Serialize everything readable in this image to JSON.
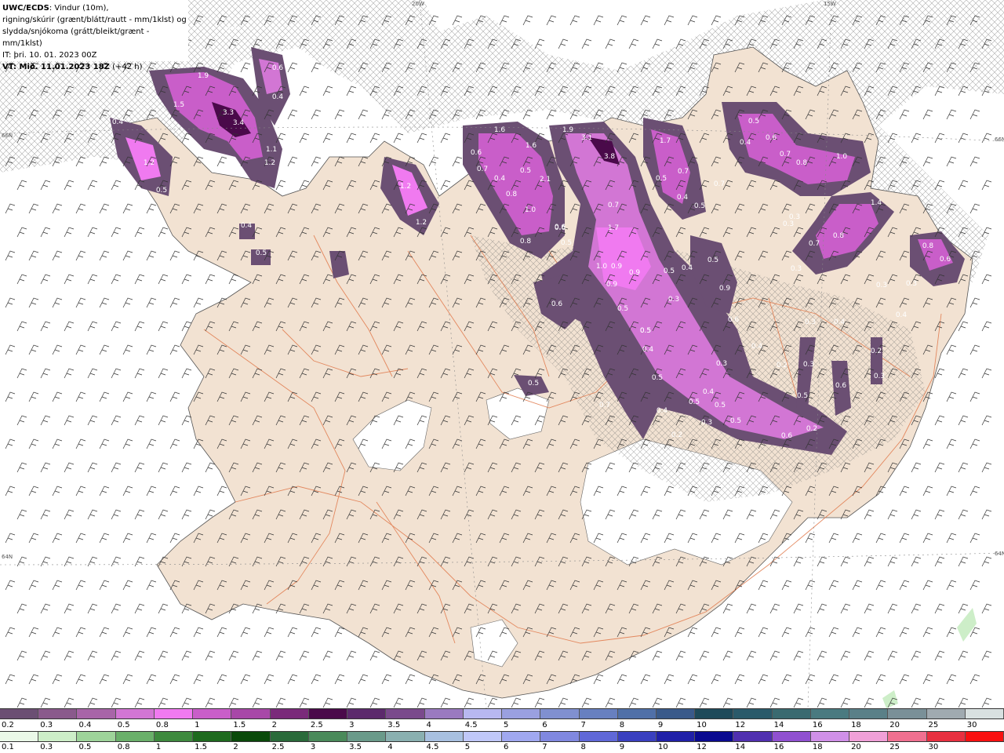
{
  "header": {
    "model": "UWC/ECDS",
    "model_suffix": ": Vindur (10m),",
    "line2": "rigning/skúrir (grænt/blátt/rautt - mm/1klst) og",
    "line3": "slydda/snjókoma (grátt/bleikt/grænt - mm/1klst)",
    "init_time": "IT: þri. 10. 01. 2023 00Z",
    "valid_label": "VT: Mið. 11.01.2023 18Z",
    "valid_suffix": " (+42 h)"
  },
  "graticule": {
    "lon_top_left": "20W",
    "lon_top_right": "15W",
    "lat_left_upper": "66N",
    "lat_right_upper": "66N",
    "lat_left_lower": "64N",
    "lat_right_lower": "64N"
  },
  "precip_labels": [
    "0.3",
    "1.9",
    "1.5",
    "3.3",
    "3.4",
    "0.6",
    "0.4",
    "0.4",
    "1.1",
    "1.2",
    "1.2",
    "0.5",
    "0.4",
    "0.5",
    "1.2",
    "1.2",
    "0.6",
    "1.6",
    "1.6",
    "0.6",
    "0.7",
    "0.4",
    "0.5",
    "2.1",
    "0.8",
    "1.0",
    "0.8",
    "0.6",
    "0.5",
    "1.9",
    "3.1",
    "3.8",
    "0.7",
    "1.7",
    "1.0",
    "0.9",
    "0.9",
    "0.5",
    "0.4",
    "0.3",
    "0.5",
    "0.9",
    "0.5",
    "0.9",
    "0.5",
    "1.7",
    "0.7",
    "0.5",
    "0.4",
    "0.5",
    "0.7",
    "0.5",
    "0.4",
    "0.6",
    "0.7",
    "0.8",
    "1.0",
    "0.3",
    "0.3",
    "1.4",
    "0.8",
    "0.7",
    "0.3",
    "0.8",
    "0.6",
    "0.3",
    "0.3",
    "0.4",
    "0.4",
    "0.3",
    "0.2",
    "0.4",
    "0.3",
    "0.2",
    "0.3",
    "0.3",
    "0.6",
    "0.5",
    "0.5",
    "0.5",
    "0.4",
    "0.5",
    "0.5",
    "0.3",
    "0.4",
    "0.7",
    "0.2",
    "0.6",
    "0.2",
    "0.5",
    "0.4",
    "0.6",
    "0.6",
    "0.5"
  ],
  "snow_scale": {
    "ticks": [
      "0.2",
      "0.3",
      "0.4",
      "0.5",
      "0.8",
      "1",
      "1.5",
      "2",
      "2.5",
      "3",
      "3.5",
      "4",
      "4.5",
      "5",
      "6",
      "7",
      "8",
      "9",
      "10",
      "12",
      "14",
      "16",
      "18",
      "20",
      "25",
      "30"
    ],
    "colors": [
      "#6b4f73",
      "#8a5a8c",
      "#a865a8",
      "#d276d4",
      "#f07af0",
      "#c95ec9",
      "#a848a8",
      "#7a2a7a",
      "#4a0a4a",
      "#5c2a6c",
      "#7a4a8c",
      "#9a7ac0",
      "#b8b8f0",
      "#9aa0e0",
      "#8090d0",
      "#6880c0",
      "#5070a8",
      "#3a5a8a",
      "#1e4a5a",
      "#2a5a6a",
      "#3a6a70",
      "#4a7a80",
      "#5a8088",
      "#7a9098",
      "#a0aab0",
      "#d8e0e0"
    ]
  },
  "rain_scale": {
    "ticks": [
      "0.1",
      "0.3",
      "0.5",
      "0.8",
      "1",
      "1.5",
      "2",
      "2.5",
      "3",
      "3.5",
      "4",
      "4.5",
      "5",
      "6",
      "7",
      "8",
      "9",
      "10",
      "12",
      "14",
      "16",
      "18",
      "20",
      "25",
      "30"
    ],
    "colors": [
      "#eaf8e8",
      "#cdeec8",
      "#9ed49a",
      "#6ab06a",
      "#3e8a3e",
      "#1e6a1e",
      "#0a4a0a",
      "#2a6a3a",
      "#4a8a5a",
      "#6a9a8a",
      "#8ab0b0",
      "#a8c0e0",
      "#c0c8f8",
      "#a0a8f0",
      "#8088e0",
      "#6068d8",
      "#3a40c0",
      "#2020a8",
      "#0a0a90",
      "#5030b0",
      "#9050d0",
      "#d090e8",
      "#f0a0d8",
      "#f07090",
      "#e83040",
      "#f81010"
    ]
  }
}
